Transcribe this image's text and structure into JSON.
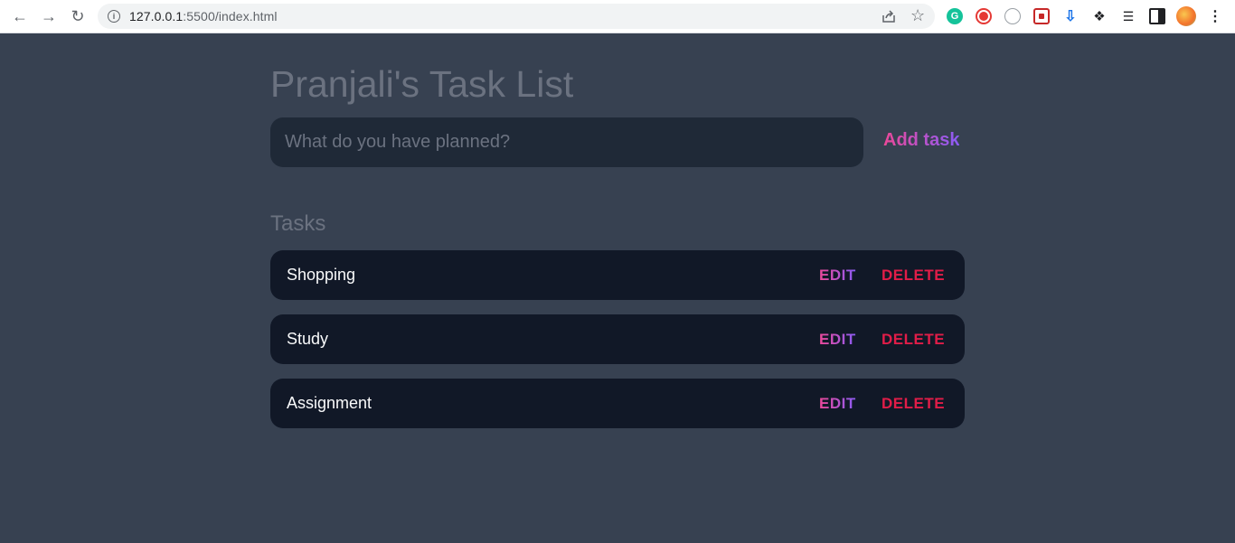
{
  "browser": {
    "url_host": "127.0.0.1",
    "url_rest": ":5500/index.html",
    "icons": {
      "back": "arrow-left-icon",
      "forward": "arrow-right-icon",
      "reload": "reload-icon",
      "info": "info-icon",
      "share": "share-icon",
      "bookmark": "star-icon"
    },
    "extensions": [
      "grammarly-icon",
      "record-icon",
      "globe-icon",
      "capture-icon",
      "download-icon",
      "puzzle-icon",
      "playlist-icon",
      "side-panel-icon",
      "avatar",
      "menu-icon"
    ]
  },
  "app": {
    "title": "Pranjali's Task List",
    "input_placeholder": "What do you have planned?",
    "add_task_label": "Add task",
    "tasks_heading": "Tasks",
    "edit_label": "EDIT",
    "delete_label": "DELETE",
    "tasks": [
      "Shopping",
      "Study",
      "Assignment"
    ]
  },
  "colors": {
    "background": "#374151",
    "input_bg": "#1f2937",
    "row_bg": "#111827",
    "accent_gradient_start": "#ec4899",
    "accent_gradient_end": "#8b5cf6",
    "delete": "#e11d48"
  }
}
